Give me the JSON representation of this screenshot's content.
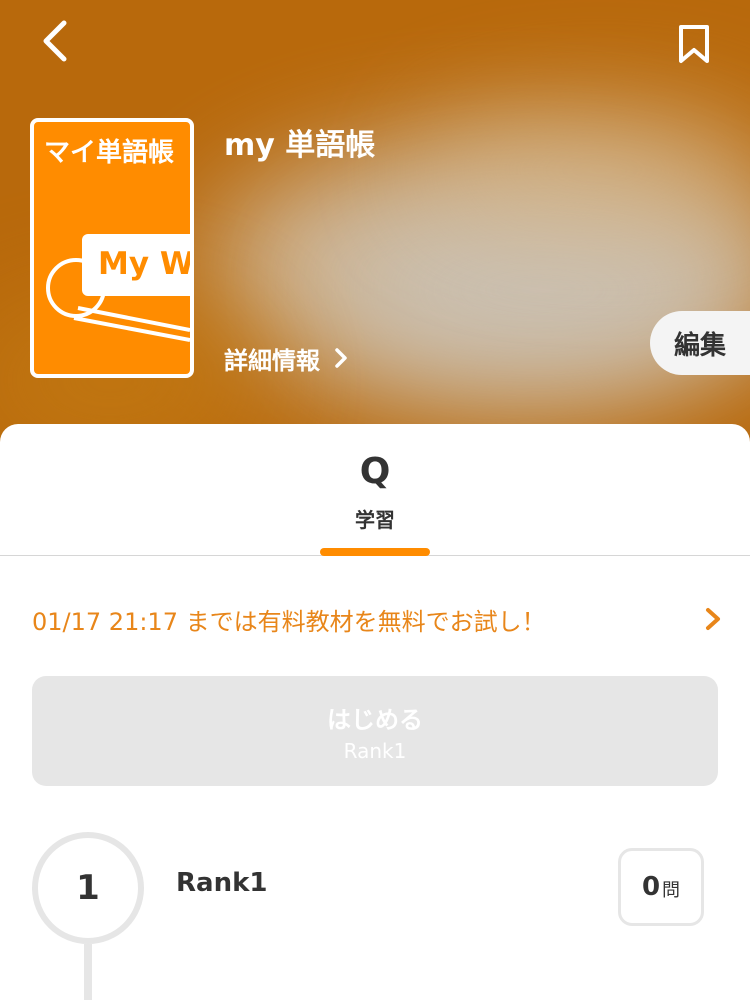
{
  "header": {
    "back_icon": "chevron-left-icon",
    "bookmark_icon": "bookmark-icon",
    "cover_title": "マイ単語帳",
    "cover_card_text": "My Wo",
    "book_title": "my 単語帳",
    "details_label": "詳細情報",
    "edit_label": "編集"
  },
  "tabs": [
    {
      "label": "学習",
      "icon": "Q",
      "active": true
    }
  ],
  "promo": {
    "text": "01/17 21:17 までは有料教材を無料でお試し！"
  },
  "start": {
    "label": "はじめる",
    "sub": "Rank1"
  },
  "ranks": [
    {
      "number": "1",
      "name": "Rank1",
      "count": "0",
      "unit": "問"
    }
  ],
  "colors": {
    "accent": "#ff8c00",
    "header_bg": "#b8690c",
    "promo_text": "#e8861a",
    "disabled_bg": "#e6e6e6",
    "text_dark": "#333333"
  }
}
